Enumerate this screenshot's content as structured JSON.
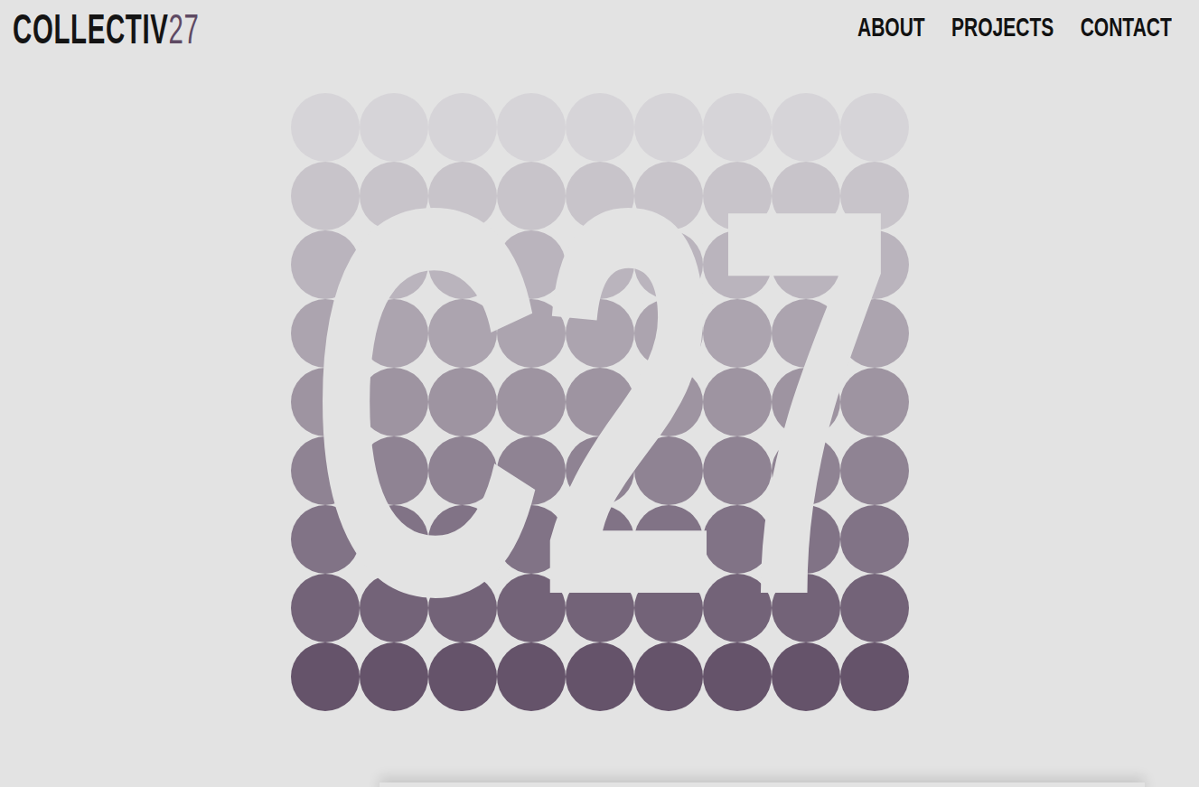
{
  "logo": {
    "text": "COLLECTIV",
    "accent": "27"
  },
  "nav": [
    {
      "label": "ABOUT"
    },
    {
      "label": "PROJECTS"
    },
    {
      "label": "CONTACT"
    }
  ],
  "hero": {
    "text": "C27"
  }
}
